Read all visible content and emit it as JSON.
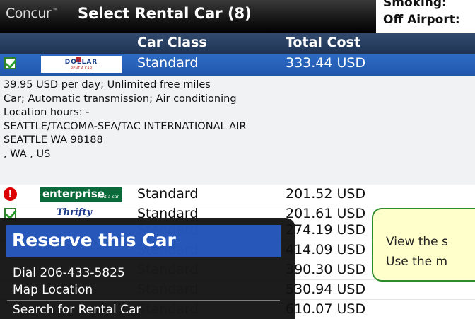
{
  "app": {
    "logo": "Concur",
    "title": "Select Rental Car (8)"
  },
  "right_info": {
    "smoking_label": "Smoking:",
    "off_airport_label": "Off Airport:"
  },
  "columns": {
    "car_class": "Car Class",
    "total_cost": "Total Cost"
  },
  "selected": {
    "vendor": "Dollar",
    "car_class": "Standard",
    "total_cost": "333.44 USD",
    "details": [
      "39.95 USD per day; Unlimited free miles",
      "Car; Automatic transmission; Air conditioning",
      "Location hours:  -",
      "SEATTLE/TACOMA-SEA/TAC INTERNATIONAL AIR",
      "SEATTLE WA 98188",
      ", WA , US"
    ]
  },
  "rows": [
    {
      "vendor": "enterprise",
      "status": "warning",
      "car_class": "Standard",
      "total_cost": "201.52 USD"
    },
    {
      "vendor": "Thrifty",
      "status": "ok",
      "car_class": "Standard",
      "total_cost": "201.61 USD"
    },
    {
      "car_class": "Standard",
      "total_cost": "274.19 USD"
    },
    {
      "car_class": "Standard",
      "total_cost": "414.09 USD"
    },
    {
      "car_class": "Standard",
      "total_cost": "390.30 USD"
    },
    {
      "car_class": "Standard",
      "total_cost": "530.94 USD"
    },
    {
      "car_class": "Standard",
      "total_cost": "610.07 USD"
    }
  ],
  "menu": {
    "header": "Reserve this Car",
    "items": [
      "Dial 206-433-5825",
      "Map Location",
      "Search for Rental Car"
    ]
  },
  "tooltip": {
    "line1": "View the s",
    "line2": "Use the m"
  },
  "logo_text": {
    "dollar": "DOLLAR",
    "dollar_sub": "RENT A CAR",
    "enterprise": "enterprise",
    "enterprise_sub": "rent-a-car",
    "thrifty": "Thrifty"
  },
  "icons": {
    "checkbox": "check-box-icon",
    "warning": "warning-icon"
  },
  "colors": {
    "selected_row": "#2f6bc4",
    "header_bg": "#253d60",
    "menu_header": "#1c4fb5",
    "tooltip_bg": "#ffffcc",
    "tooltip_border": "#2e8b2e",
    "warning": "#dd0000"
  }
}
